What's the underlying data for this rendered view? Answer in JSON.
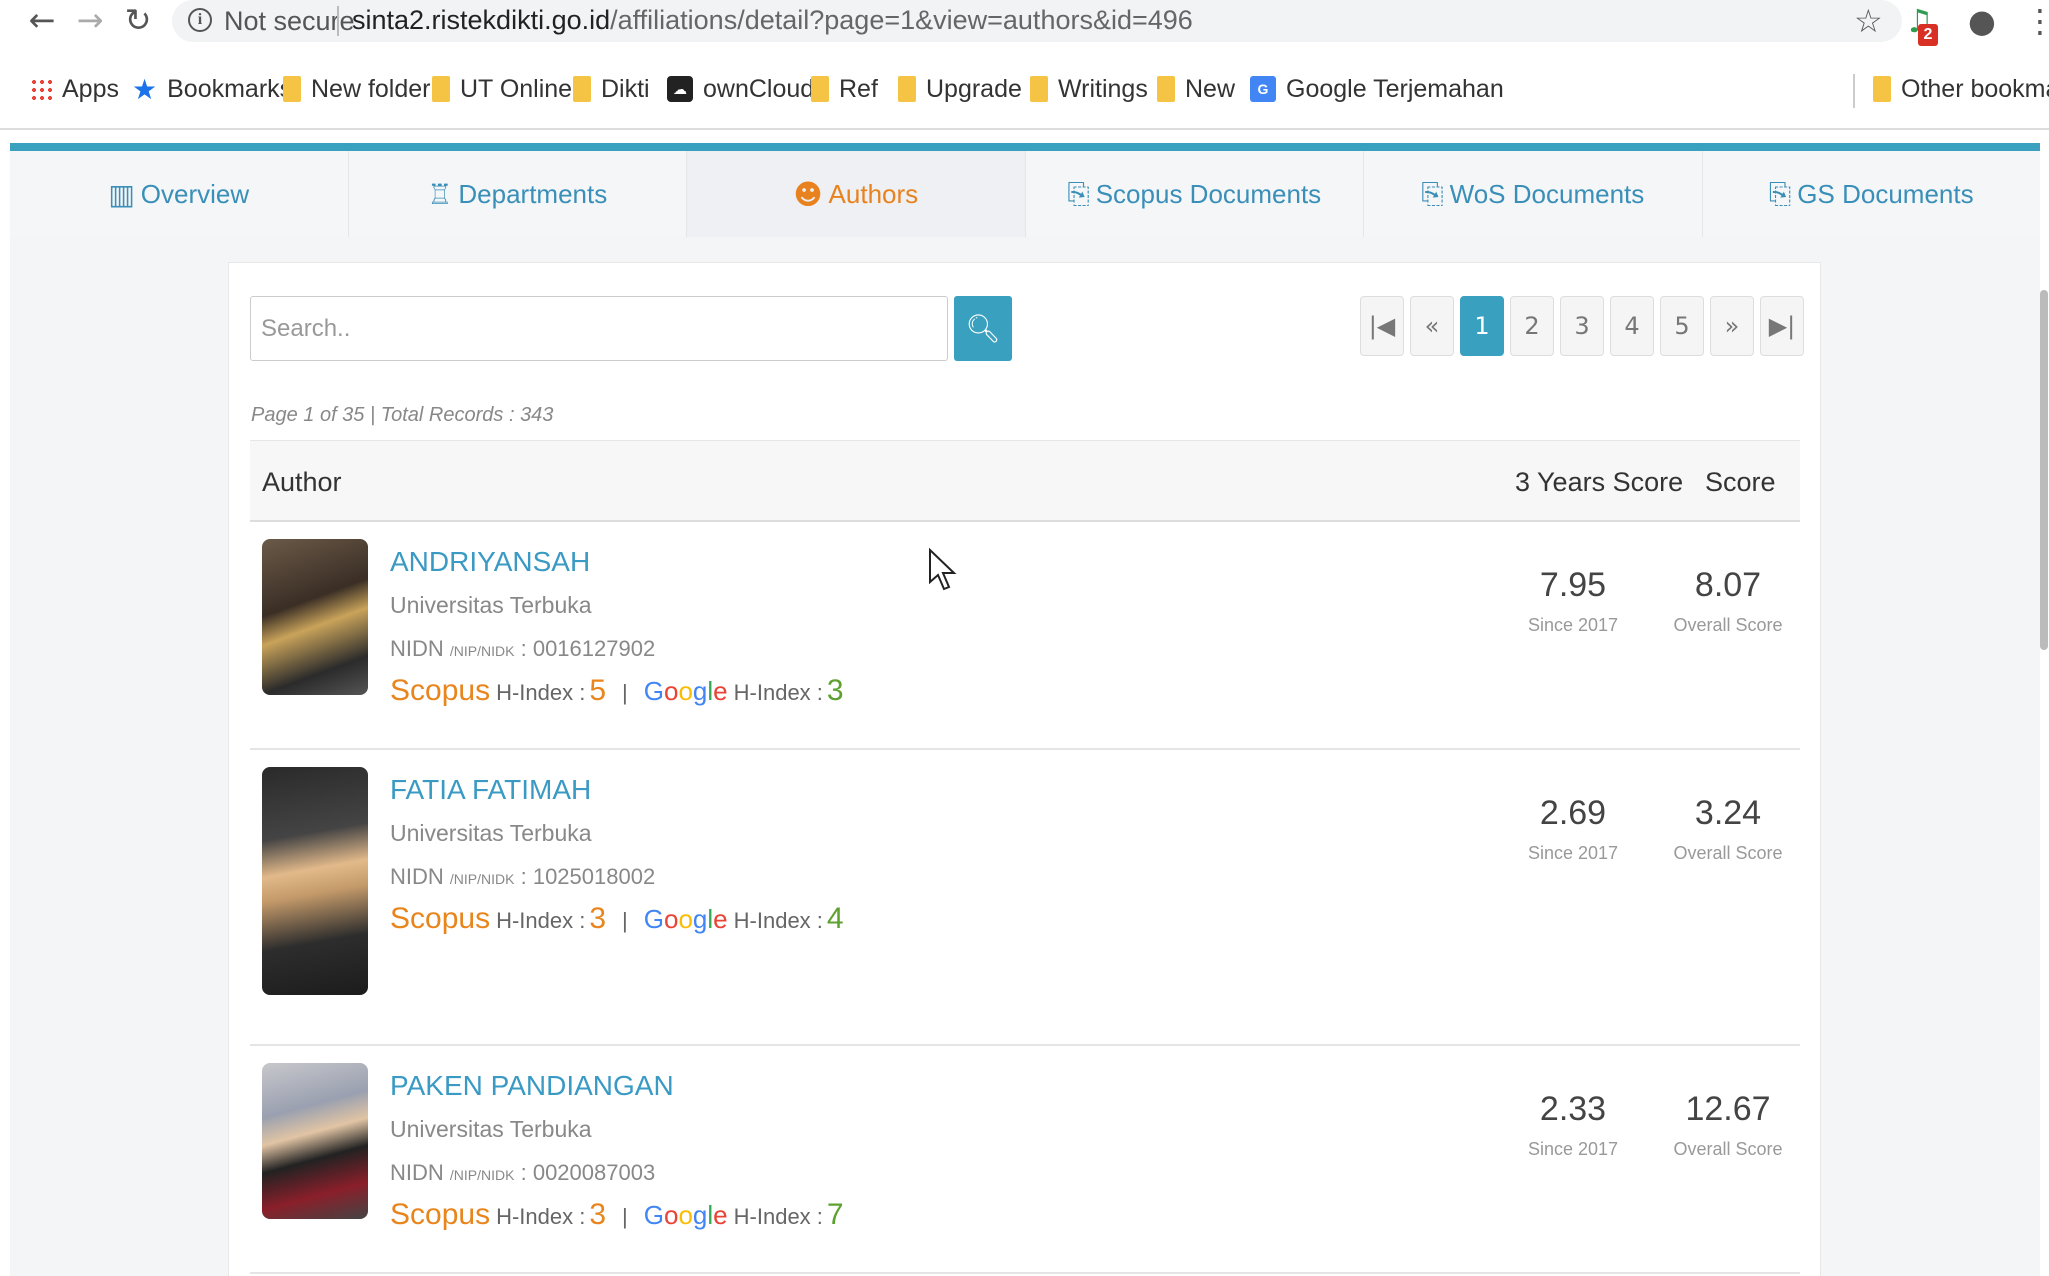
{
  "browser": {
    "not_secure": "Not secure",
    "url_host": "sinta2.ristekdikti.go.id",
    "url_path": "/affiliations/detail?page=1&view=authors&id=496",
    "ext_badge": "2"
  },
  "bookmarks": [
    {
      "label": "Apps",
      "icon": "apps-grid-icon"
    },
    {
      "label": "Bookmarks",
      "icon": "star-icon"
    },
    {
      "label": "New folder",
      "icon": "folder-icon"
    },
    {
      "label": "UT Online",
      "icon": "folder-icon"
    },
    {
      "label": "Dikti",
      "icon": "folder-icon"
    },
    {
      "label": "ownCloud",
      "icon": "owncloud-icon"
    },
    {
      "label": "Ref",
      "icon": "folder-icon"
    },
    {
      "label": "Upgrade",
      "icon": "folder-icon"
    },
    {
      "label": "Writings",
      "icon": "folder-icon"
    },
    {
      "label": "New",
      "icon": "folder-icon"
    },
    {
      "label": "Google Terjemahan",
      "icon": "google-translate-icon"
    },
    {
      "label": "Other bookmarks",
      "icon": "folder-icon"
    }
  ],
  "tabs": [
    {
      "label": "Overview",
      "icon": "bar-chart-icon"
    },
    {
      "label": "Departments",
      "icon": "sitemap-icon"
    },
    {
      "label": "Authors",
      "icon": "users-icon"
    },
    {
      "label": "Scopus Documents",
      "icon": "documents-icon"
    },
    {
      "label": "WoS Documents",
      "icon": "documents-icon"
    },
    {
      "label": "GS Documents",
      "icon": "documents-icon"
    }
  ],
  "active_tab": "Authors",
  "colors": {
    "accent": "#3aa0c0",
    "active_tab": "#e8821e",
    "scopus": "#e8851d",
    "google_hindex": "#5da130"
  },
  "search": {
    "placeholder": "Search.."
  },
  "pagination": {
    "first": "⏮",
    "prev": "«",
    "pages": [
      "1",
      "2",
      "3",
      "4",
      "5"
    ],
    "current": "1",
    "next": "»",
    "last": "⏭"
  },
  "page_info": "Page 1 of 35 | Total Records : 343",
  "table": {
    "col_author": "Author",
    "col_3yr": "3 Years Score",
    "col_score": "Score"
  },
  "labels": {
    "nidn": "NIDN",
    "nidn_small": "/NIP/NIDK",
    "scopus": "Scopus",
    "google": "Google",
    "hindex": "H-Index :",
    "separator": "|",
    "since": "Since 2017",
    "overall": "Overall Score"
  },
  "authors": [
    {
      "name": "ANDRIYANSAH",
      "affiliation": "Universitas Terbuka",
      "nidn": ": 0016127902",
      "scopus_h": "5",
      "google_h": "3",
      "score_3yr": "7.95",
      "score": "8.07"
    },
    {
      "name": "FATIA FATIMAH",
      "affiliation": "Universitas Terbuka",
      "nidn": ": 1025018002",
      "scopus_h": "3",
      "google_h": "4",
      "score_3yr": "2.69",
      "score": "3.24"
    },
    {
      "name": "PAKEN PANDIANGAN",
      "affiliation": "Universitas Terbuka",
      "nidn": ": 0020087003",
      "scopus_h": "3",
      "google_h": "7",
      "score_3yr": "2.33",
      "score": "12.67"
    }
  ]
}
